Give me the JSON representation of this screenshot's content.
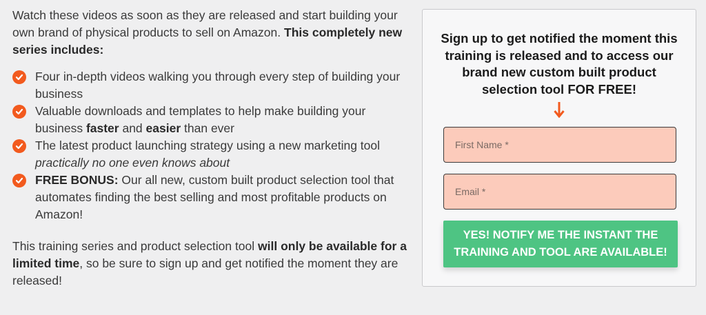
{
  "intro": {
    "text": "Watch these videos as soon as they are released and start building your own brand of physical products to sell on Amazon.",
    "bold": "This completely new series includes:"
  },
  "features": [
    {
      "pre": "Four in-depth videos walking you through every step of building your business"
    },
    {
      "pre": "Valuable downloads and templates to help make building your business ",
      "b1": "faster",
      "mid": " and ",
      "b2": "easier",
      "post": " than ever"
    },
    {
      "pre": "The latest product launching strategy using a new marketing tool ",
      "italic": "practically no one even knows about"
    },
    {
      "bold": "FREE BONUS:",
      "post": " Our all new, custom built product selection tool that automates finding the best selling and most profitable products on Amazon!"
    }
  ],
  "outro": {
    "pre": "This training series and product selection tool ",
    "bold": "will only be available for a limited time",
    "post": ", so be sure to sign up and get notified the moment they are released!"
  },
  "form": {
    "heading": "Sign up to get notified the moment this training is released and to access our brand new custom built product selection tool FOR FREE!",
    "first_name_placeholder": "First Name *",
    "email_placeholder": "Email *",
    "submit_label": "YES! NOTIFY ME THE INSTANT THE TRAINING AND TOOL ARE AVAILABLE!"
  },
  "colors": {
    "accent_orange": "#f25a1e",
    "field_bg": "#fccbbb",
    "button_green": "#4ec483"
  },
  "icons": {
    "bullet": "check-circle-icon",
    "pointer": "arrow-down-icon"
  }
}
